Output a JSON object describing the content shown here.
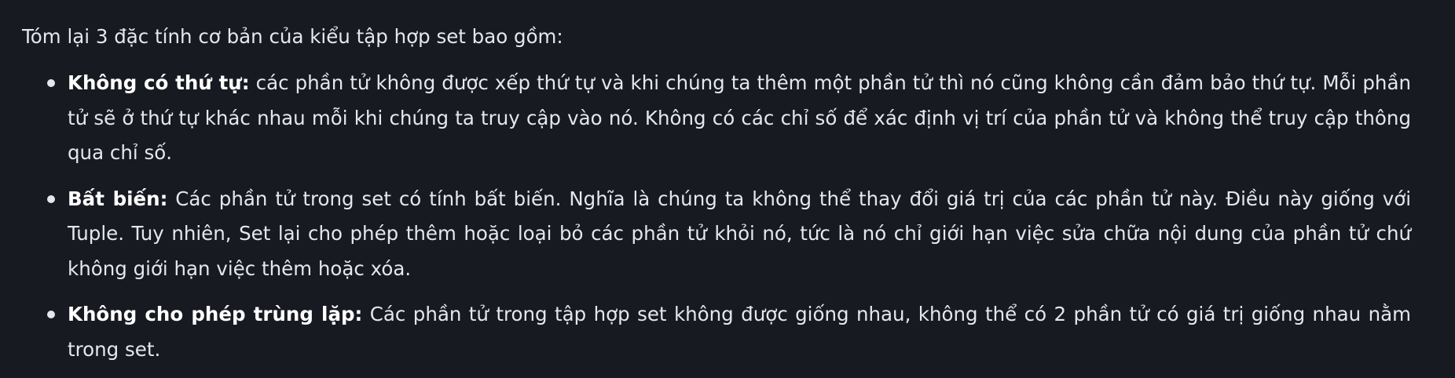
{
  "intro_text": "Tóm lại 3 đặc tính cơ bản của kiểu tập hợp set bao gồm:",
  "items": [
    {
      "term": "Không có thứ tự:",
      "description": "các phần tử không được xếp thứ tự và khi chúng ta thêm một phần tử thì nó cũng không cần đảm bảo thứ tự. Mỗi phần tử sẽ ở thứ tự khác nhau mỗi khi chúng ta truy cập vào nó. Không có các chỉ số để xác định vị trí của phần tử và không thể truy cập thông qua chỉ số."
    },
    {
      "term": "Bất biến:",
      "description": "Các phần tử trong set có tính bất biến. Nghĩa là chúng ta không thể thay đổi giá trị của các phần tử này. Điều này giống với Tuple. Tuy nhiên, Set lại cho phép thêm hoặc loại bỏ các phần tử khỏi nó, tức là nó chỉ giới hạn việc sửa chữa nội dung của phần tử chứ không giới hạn việc thêm hoặc xóa."
    },
    {
      "term": "Không cho phép trùng lặp:",
      "description": "Các phần tử trong tập hợp set không được giống nhau, không thể có 2 phần tử có giá trị giống nhau nằm trong set."
    }
  ]
}
